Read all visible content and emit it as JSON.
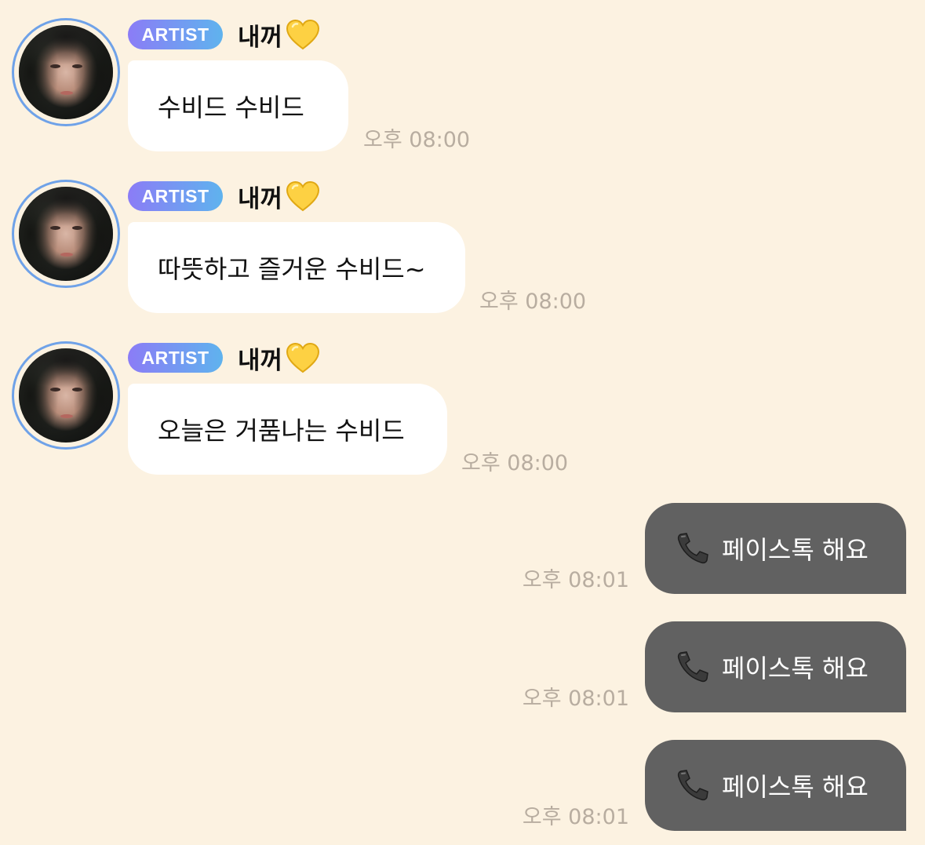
{
  "chat": {
    "incoming": [
      {
        "badge": "ARTIST",
        "name": "내꺼",
        "heart_icon": "yellow-heart-icon",
        "text": "수비드 수비드",
        "time": "오후 08:00"
      },
      {
        "badge": "ARTIST",
        "name": "내꺼",
        "heart_icon": "yellow-heart-icon",
        "text": "따뜻하고 즐거운 수비드~",
        "time": "오후 08:00"
      },
      {
        "badge": "ARTIST",
        "name": "내꺼",
        "heart_icon": "yellow-heart-icon",
        "text": "오늘은 거품나는 수비드",
        "time": "오후 08:00"
      }
    ],
    "outgoing": [
      {
        "icon": "telephone-icon",
        "text": "페이스톡 해요",
        "time": "오후 08:01"
      },
      {
        "icon": "telephone-icon",
        "text": "페이스톡 해요",
        "time": "오후 08:01"
      },
      {
        "icon": "telephone-icon",
        "text": "페이스톡 해요",
        "time": "오후 08:01"
      }
    ]
  },
  "colors": {
    "background": "#fcf2e1",
    "incoming_bubble": "#ffffff",
    "outgoing_bubble": "#616161",
    "badge_gradient_start": "#8b7cf6",
    "badge_gradient_end": "#5fb3ee",
    "avatar_ring": "#6fa2e8",
    "timestamp": "#b8ada0"
  }
}
